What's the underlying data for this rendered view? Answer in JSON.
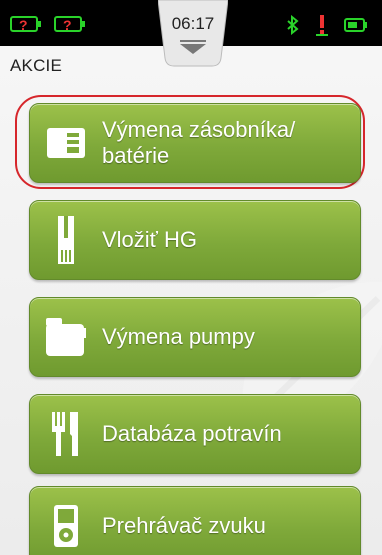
{
  "status_bar": {
    "time": "06:17",
    "icons": [
      "battery-alert-icon",
      "battery-alert-icon",
      "bluetooth-icon",
      "alert-icon",
      "battery-icon"
    ]
  },
  "header": {
    "title": "AKCIE"
  },
  "menu": {
    "items": [
      {
        "label": "Výmena zásobníka/ batérie",
        "line1": "Výmena zásobníka/",
        "line2": "batérie",
        "icon": "cartridge-battery-icon",
        "selected": true
      },
      {
        "label": "Vložiť HG",
        "icon": "test-strip-icon"
      },
      {
        "label": "Výmena pumpy",
        "icon": "pump-icon"
      },
      {
        "label": "Databáza potravín",
        "icon": "fork-knife-icon"
      },
      {
        "label": "Prehrávač zvuku",
        "icon": "audio-player-icon"
      }
    ]
  },
  "colors": {
    "button_green": "#7fa93a",
    "selection_ring": "#d6262b",
    "status_green": "#2ad32a"
  }
}
